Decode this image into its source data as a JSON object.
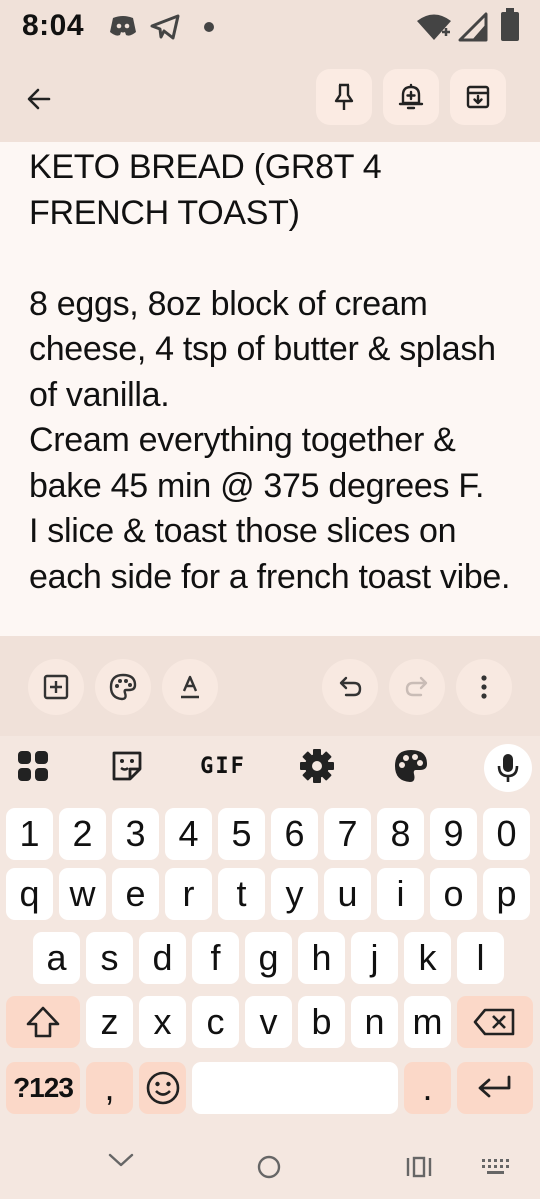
{
  "status_bar": {
    "time": "8:04",
    "icons": [
      "discord-icon",
      "telegram-icon",
      "dot-icon",
      "wifi-icon",
      "signal-icon",
      "battery-icon"
    ]
  },
  "toolbar": {
    "icons": [
      "back-arrow-icon",
      "pin-icon",
      "reminder-bell-icon",
      "archive-icon"
    ]
  },
  "note": {
    "text": "KETO BREAD (GR8T 4 FRENCH TOAST)\n\n8 eggs, 8oz block of cream cheese, 4 tsp of butter & splash of vanilla.\nCream everything together & bake 45 min @ 375 degrees F.\nI slice & toast those slices on each side for a french toast vibe."
  },
  "edit_toolbar": {
    "icons": [
      "add-box-icon",
      "palette-icon",
      "text-format-icon",
      "undo-icon",
      "redo-icon",
      "more-vert-icon"
    ]
  },
  "keyboard": {
    "tools": {
      "gif_label": "GIF",
      "icons": [
        "apps-grid-icon",
        "sticker-icon",
        "settings-gear-icon",
        "theme-palette-icon",
        "mic-icon"
      ]
    },
    "rows": {
      "numbers": [
        "1",
        "2",
        "3",
        "4",
        "5",
        "6",
        "7",
        "8",
        "9",
        "0"
      ],
      "row1": [
        "q",
        "w",
        "e",
        "r",
        "t",
        "y",
        "u",
        "i",
        "o",
        "p"
      ],
      "row2": [
        "a",
        "s",
        "d",
        "f",
        "g",
        "h",
        "j",
        "k",
        "l"
      ],
      "row3": [
        "z",
        "x",
        "c",
        "v",
        "b",
        "n",
        "m"
      ]
    },
    "symbols_label": "?123",
    "comma": ",",
    "period": ".",
    "special_icons": [
      "shift-icon",
      "backspace-icon",
      "emoji-icon",
      "enter-icon"
    ]
  },
  "nav_bar": {
    "icons": [
      "hide-keyboard-chevron-icon",
      "home-circle-icon",
      "recents-icon",
      "keyboard-switch-icon"
    ]
  },
  "colors": {
    "header_bg": "#f0e1d9",
    "note_bg": "#fdf7f4",
    "keyboard_bg": "#f4e7e0",
    "special_key": "#fbd8c8"
  }
}
